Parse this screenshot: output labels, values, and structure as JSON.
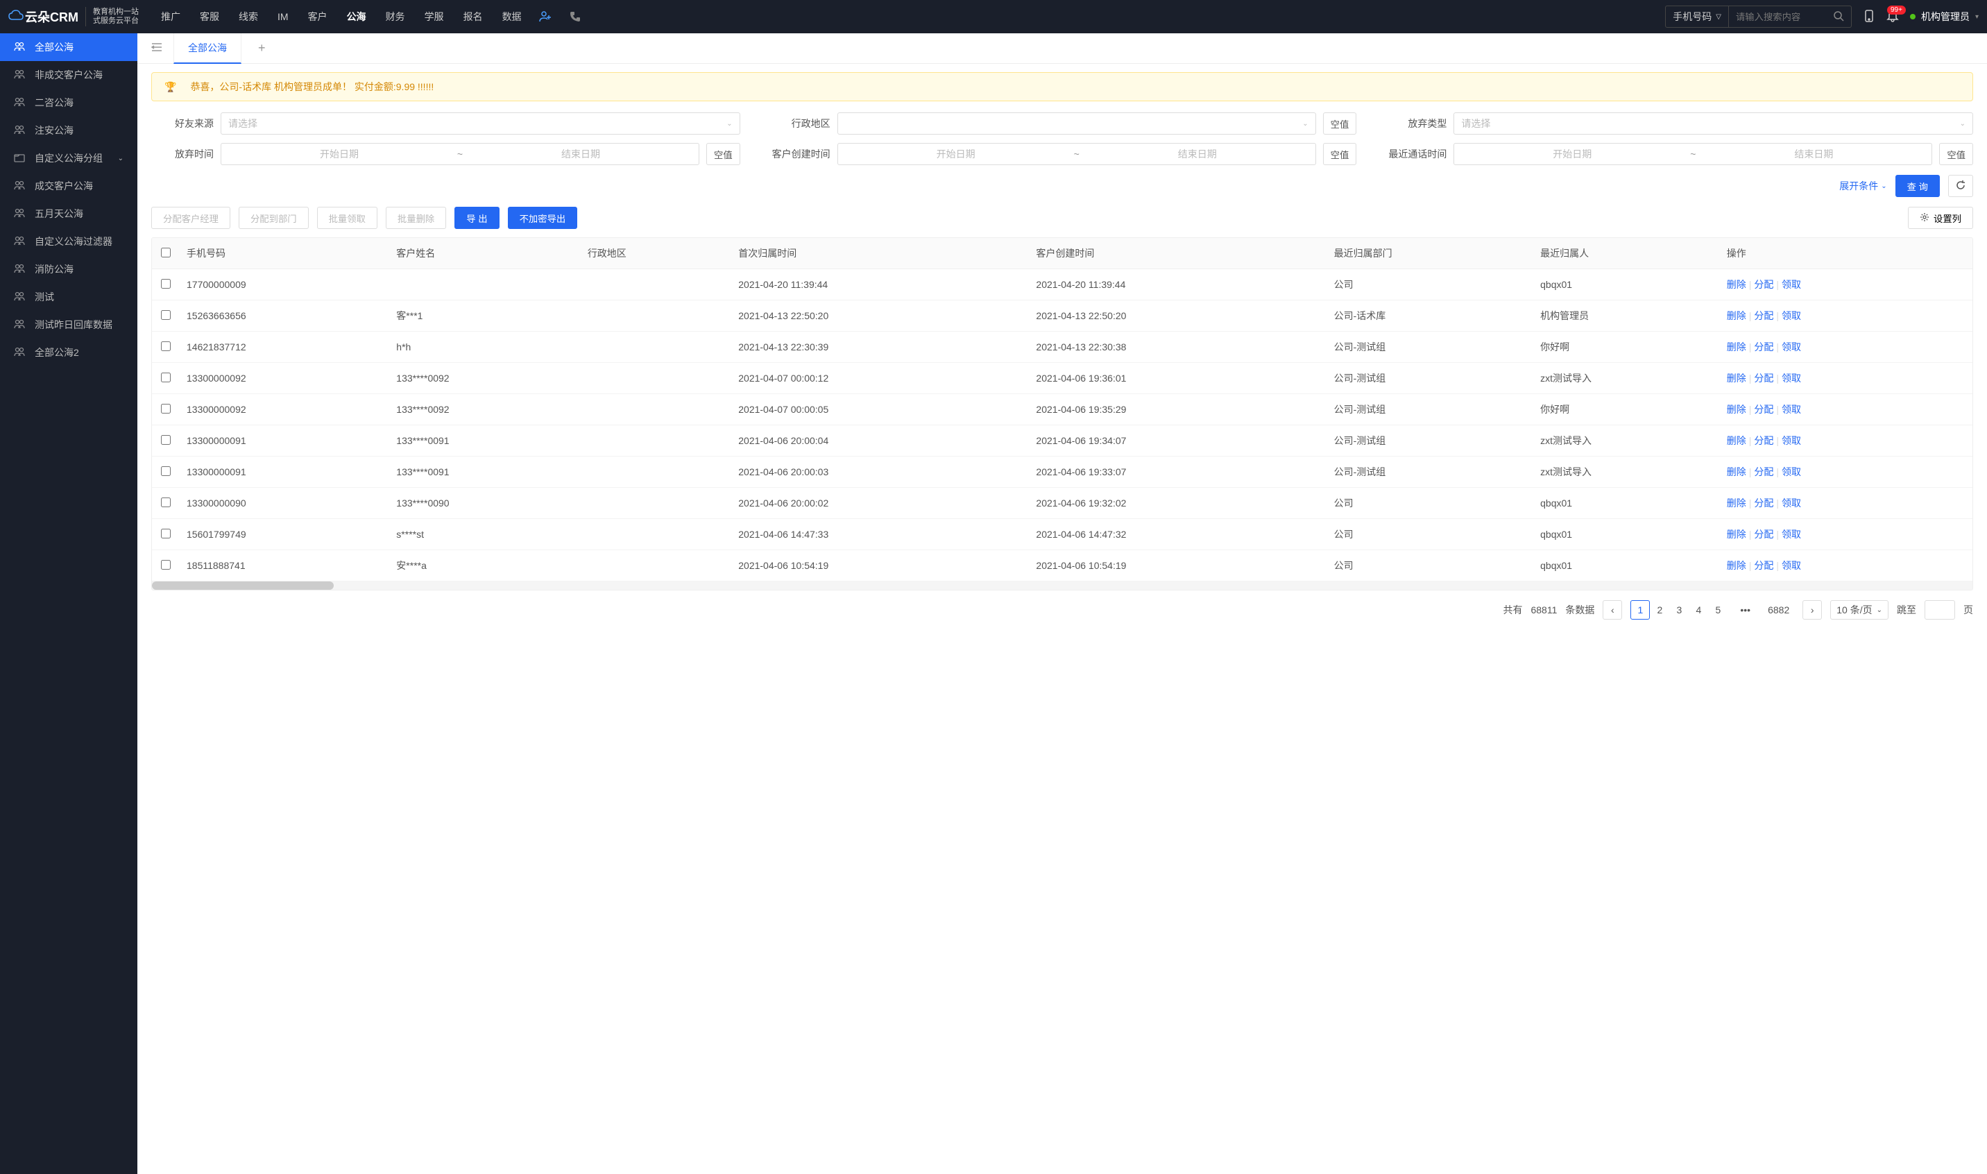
{
  "header": {
    "logo_main": "云朵CRM",
    "logo_url": "www.yunduocrm.com",
    "logo_sub1": "教育机构一站",
    "logo_sub2": "式服务云平台",
    "nav": [
      "推广",
      "客服",
      "线索",
      "IM",
      "客户",
      "公海",
      "财务",
      "学服",
      "报名",
      "数据"
    ],
    "nav_active_index": 5,
    "search_type": "手机号码",
    "search_placeholder": "请输入搜索内容",
    "badge": "99+",
    "user_name": "机构管理员"
  },
  "sidebar": {
    "items": [
      {
        "label": "全部公海",
        "icon": "users"
      },
      {
        "label": "非成交客户公海",
        "icon": "users"
      },
      {
        "label": "二咨公海",
        "icon": "users"
      },
      {
        "label": "注安公海",
        "icon": "users"
      },
      {
        "label": "自定义公海分组",
        "icon": "folder",
        "expandable": true
      },
      {
        "label": "成交客户公海",
        "icon": "users"
      },
      {
        "label": "五月天公海",
        "icon": "users"
      },
      {
        "label": "自定义公海过滤器",
        "icon": "users"
      },
      {
        "label": "消防公海",
        "icon": "users"
      },
      {
        "label": "测试",
        "icon": "users"
      },
      {
        "label": "测试昨日回库数据",
        "icon": "users"
      },
      {
        "label": "全部公海2",
        "icon": "users"
      }
    ],
    "active_index": 0
  },
  "tabs": {
    "active_label": "全部公海"
  },
  "alert": {
    "text": "恭喜，公司-话术库  机构管理员成单！  实付金额:9.99 !!!!!!"
  },
  "filters": {
    "friend_source": {
      "label": "好友来源",
      "placeholder": "请选择"
    },
    "admin_region": {
      "label": "行政地区",
      "placeholder": "",
      "null_btn": "空值"
    },
    "abandon_type": {
      "label": "放弃类型",
      "placeholder": "请选择"
    },
    "abandon_time": {
      "label": "放弃时间",
      "start": "开始日期",
      "end": "结束日期",
      "null_btn": "空值"
    },
    "create_time": {
      "label": "客户创建时间",
      "start": "开始日期",
      "end": "结束日期",
      "null_btn": "空值"
    },
    "last_call": {
      "label": "最近通话时间",
      "start": "开始日期",
      "end": "结束日期",
      "null_btn": "空值"
    }
  },
  "action_bar": {
    "expand": "展开条件",
    "query": "查 询"
  },
  "toolbar": {
    "assign_manager": "分配客户经理",
    "assign_dept": "分配到部门",
    "batch_claim": "批量领取",
    "batch_delete": "批量删除",
    "export": "导 出",
    "export_plain": "不加密导出",
    "columns": "设置列"
  },
  "table": {
    "headers": [
      "手机号码",
      "客户姓名",
      "行政地区",
      "首次归属时间",
      "客户创建时间",
      "最近归属部门",
      "最近归属人",
      "操作"
    ],
    "ops": {
      "delete": "删除",
      "assign": "分配",
      "claim": "领取"
    },
    "rows": [
      {
        "phone": "17700000009",
        "name": "",
        "region": "",
        "first_time": "2021-04-20 11:39:44",
        "create_time": "2021-04-20 11:39:44",
        "dept": "公司",
        "owner": "qbqx01"
      },
      {
        "phone": "15263663656",
        "name": "客***1",
        "region": "",
        "first_time": "2021-04-13 22:50:20",
        "create_time": "2021-04-13 22:50:20",
        "dept": "公司-话术库",
        "owner": "机构管理员"
      },
      {
        "phone": "14621837712",
        "name": "h*h",
        "region": "",
        "first_time": "2021-04-13 22:30:39",
        "create_time": "2021-04-13 22:30:38",
        "dept": "公司-测试组",
        "owner": "你好啊"
      },
      {
        "phone": "13300000092",
        "name": "133****0092",
        "region": "",
        "first_time": "2021-04-07 00:00:12",
        "create_time": "2021-04-06 19:36:01",
        "dept": "公司-测试组",
        "owner": "zxt测试导入"
      },
      {
        "phone": "13300000092",
        "name": "133****0092",
        "region": "",
        "first_time": "2021-04-07 00:00:05",
        "create_time": "2021-04-06 19:35:29",
        "dept": "公司-测试组",
        "owner": "你好啊"
      },
      {
        "phone": "13300000091",
        "name": "133****0091",
        "region": "",
        "first_time": "2021-04-06 20:00:04",
        "create_time": "2021-04-06 19:34:07",
        "dept": "公司-测试组",
        "owner": "zxt测试导入"
      },
      {
        "phone": "13300000091",
        "name": "133****0091",
        "region": "",
        "first_time": "2021-04-06 20:00:03",
        "create_time": "2021-04-06 19:33:07",
        "dept": "公司-测试组",
        "owner": "zxt测试导入"
      },
      {
        "phone": "13300000090",
        "name": "133****0090",
        "region": "",
        "first_time": "2021-04-06 20:00:02",
        "create_time": "2021-04-06 19:32:02",
        "dept": "公司",
        "owner": "qbqx01"
      },
      {
        "phone": "15601799749",
        "name": "s****st",
        "region": "",
        "first_time": "2021-04-06 14:47:33",
        "create_time": "2021-04-06 14:47:32",
        "dept": "公司",
        "owner": "qbqx01"
      },
      {
        "phone": "18511888741",
        "name": "安****a",
        "region": "",
        "first_time": "2021-04-06 10:54:19",
        "create_time": "2021-04-06 10:54:19",
        "dept": "公司",
        "owner": "qbqx01"
      }
    ]
  },
  "pagination": {
    "total_prefix": "共有",
    "total": "68811",
    "total_suffix": "条数据",
    "pages": [
      "1",
      "2",
      "3",
      "4",
      "5"
    ],
    "last_page": "6882",
    "size_label": "10 条/页",
    "jump_prefix": "跳至",
    "jump_suffix": "页"
  }
}
